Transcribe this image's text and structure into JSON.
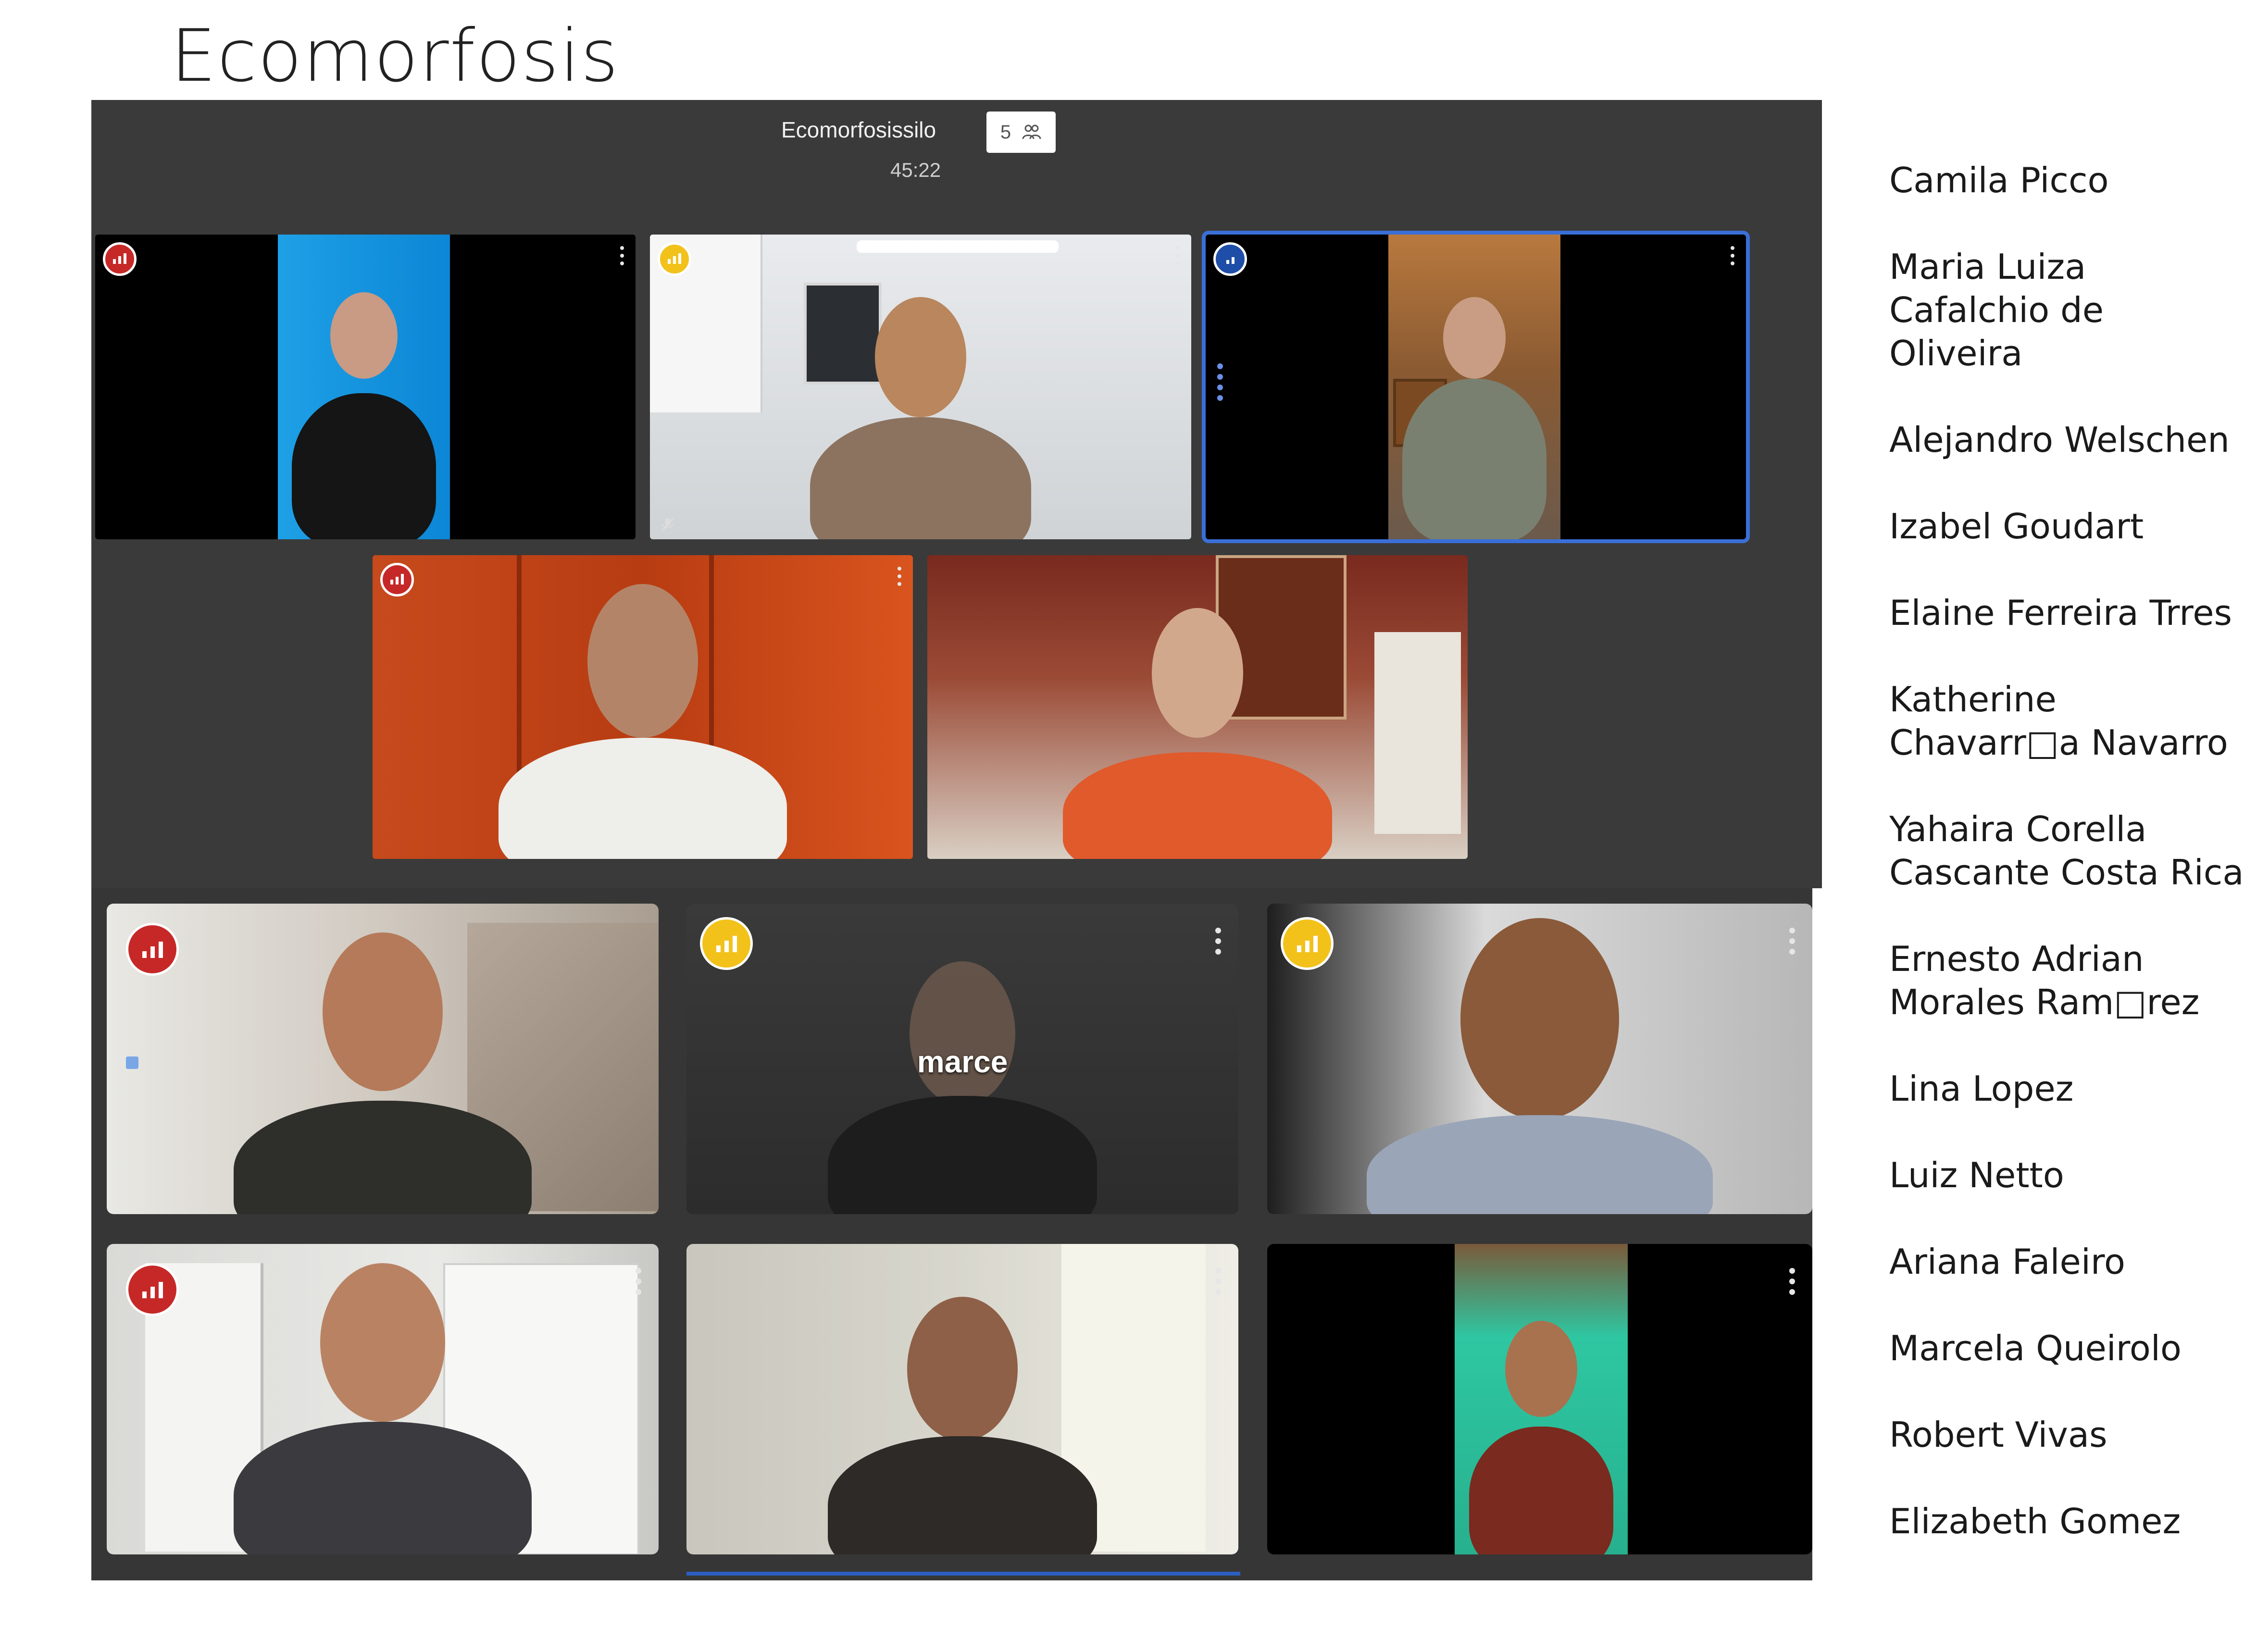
{
  "page": {
    "title": "Ecomorfosis"
  },
  "meeting": {
    "name": "Ecomorfosissilo",
    "participant_count": "5",
    "timer": "45:22"
  },
  "participants_list": [
    "Camila Picco",
    "Maria Luiza Cafalchio de Oliveira",
    "Alejandro Welschen",
    "Izabel Goudart",
    "Elaine Ferreira Trres",
    "Katherine Chavarr□a Navarro",
    "Yahaira Corella Cascante Costa Rica",
    "Ernesto Adrian Morales Ram□rez",
    "Lina Lopez",
    "Luiz Netto",
    "Ariana Faleiro",
    "Marcela Queirolo",
    "Robert Vivas",
    "Elizabeth Gomez"
  ],
  "tile_labels": {
    "marce": "marce"
  },
  "colors": {
    "signal_red": "#c62828",
    "signal_yellow": "#f2c21b",
    "active_speaker": "#1e4ea8",
    "panel_bg": "#3a3a3a"
  },
  "icons": [
    "signal-strength-icon",
    "more-options-icon",
    "people-icon",
    "mic-off-icon",
    "speaking-indicator-icon"
  ]
}
